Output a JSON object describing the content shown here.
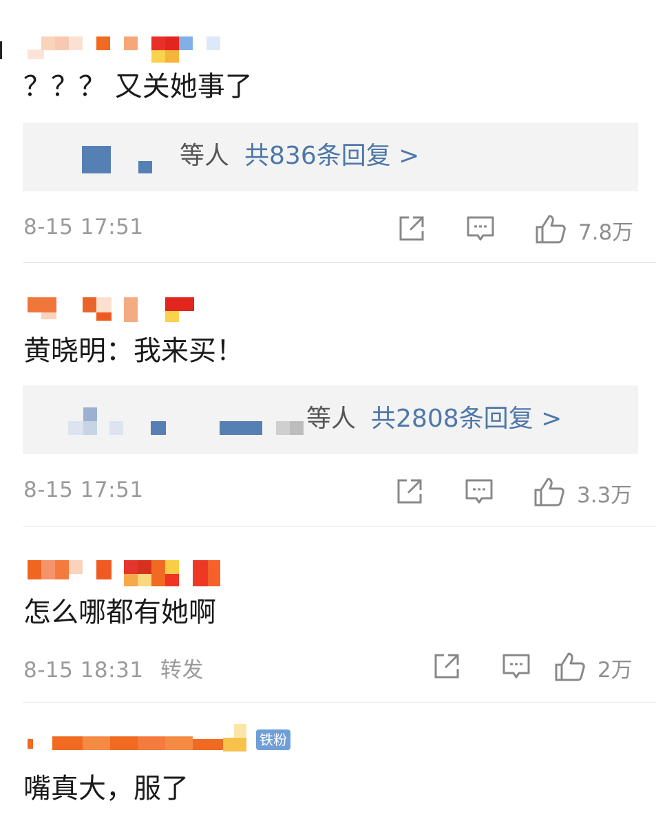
{
  "comments": [
    {
      "content": "？？？ 又关她事了",
      "reply_tail": "等人",
      "reply_count": "共836条回复 >",
      "time": "8-15 17:51",
      "likes": "7.8万"
    },
    {
      "content": "黄晓明：我来买！",
      "reply_tail": "等人",
      "reply_count": "共2808条回复 >",
      "time": "8-15 17:51",
      "likes": "3.3万"
    },
    {
      "content": "怎么哪都有她啊",
      "time": "8-15 18:31",
      "forward_label": "转发",
      "likes": "2万"
    },
    {
      "content": "嘴真大，服了",
      "badge": "铁粉"
    }
  ],
  "icons": {
    "share": "share-icon",
    "comment": "comment-icon",
    "like": "thumbs-up-icon"
  },
  "colors": {
    "link": "#4d77a8",
    "meta": "#9a9a9a",
    "reply_bg": "#f3f3f3"
  }
}
